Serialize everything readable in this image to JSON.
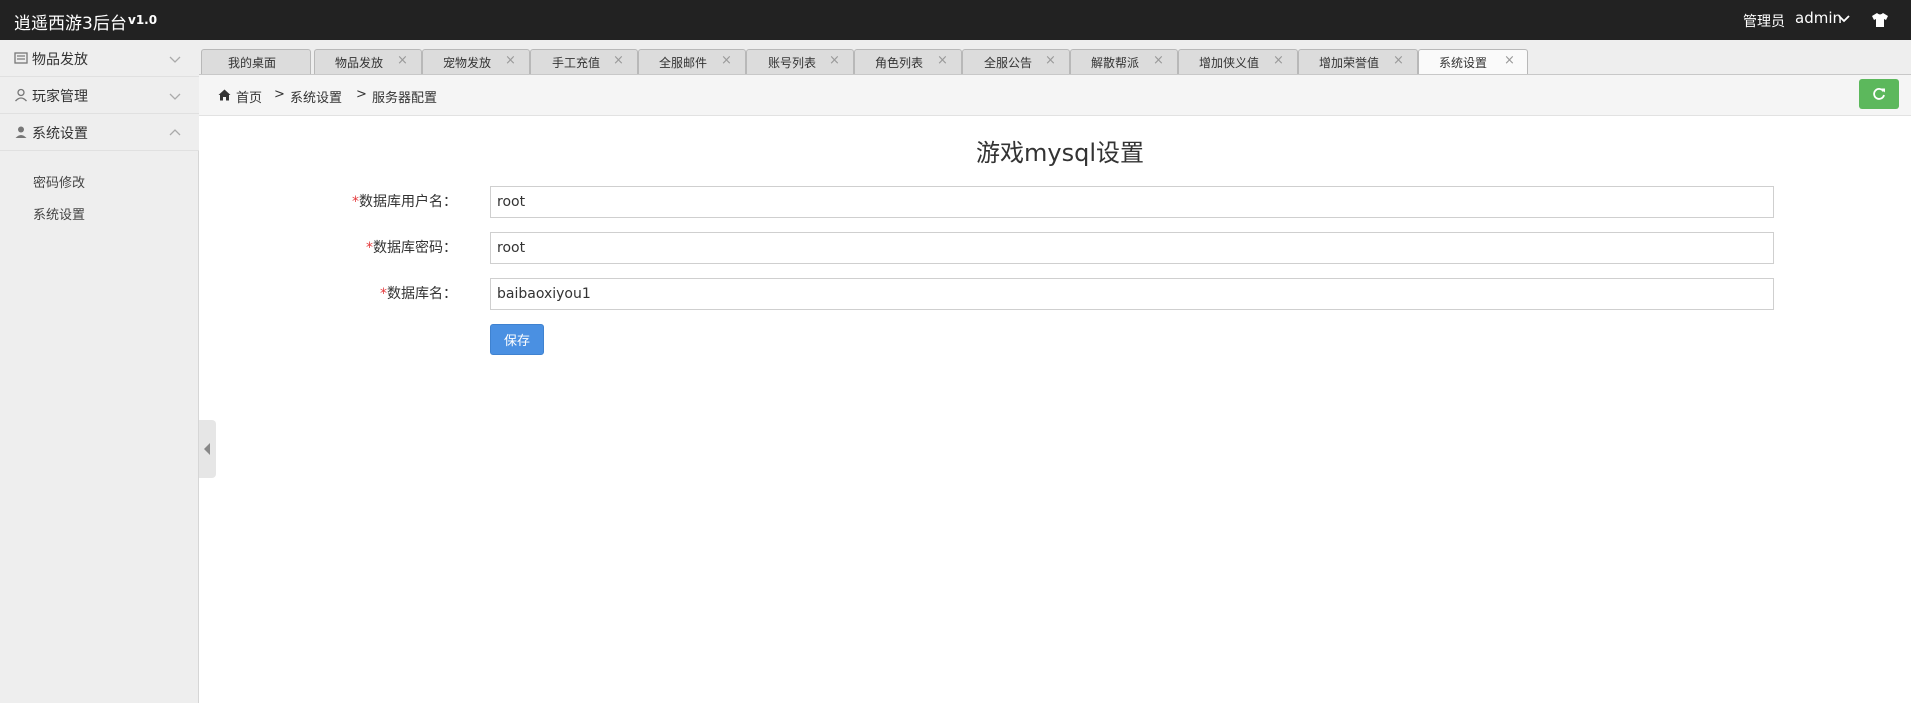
{
  "app": {
    "title": "逍遥西游3后台",
    "version": "v1.0"
  },
  "user": {
    "role": "管理员",
    "name": "admin",
    "icons": {
      "chevron": "chevron-down-icon",
      "theme": "shirt-icon"
    }
  },
  "sidebar": {
    "items": [
      {
        "label": "物品发放",
        "icon": "list-icon",
        "expanded": false
      },
      {
        "label": "玩家管理",
        "icon": "user-outline-icon",
        "expanded": false
      },
      {
        "label": "系统设置",
        "icon": "user-icon",
        "expanded": true
      }
    ],
    "subitems": [
      {
        "label": "密码修改"
      },
      {
        "label": "系统设置"
      }
    ]
  },
  "tabs": [
    {
      "label": "我的桌面",
      "closable": false
    },
    {
      "label": "物品发放",
      "closable": true
    },
    {
      "label": "宠物发放",
      "closable": true
    },
    {
      "label": "手工充值",
      "closable": true
    },
    {
      "label": "全服邮件",
      "closable": true
    },
    {
      "label": "账号列表",
      "closable": true
    },
    {
      "label": "角色列表",
      "closable": true
    },
    {
      "label": "全服公告",
      "closable": true
    },
    {
      "label": "解散帮派",
      "closable": true
    },
    {
      "label": "增加侠义值",
      "closable": true
    },
    {
      "label": "增加荣誉值",
      "closable": true
    },
    {
      "label": "系统设置",
      "closable": true,
      "active": true
    }
  ],
  "tab_close_glyph": "×",
  "breadcrumb": {
    "home": "首页",
    "sep": ">",
    "items": [
      "系统设置",
      "服务器配置"
    ]
  },
  "form": {
    "title": "游戏mysql设置",
    "required_mark": "*",
    "fields": [
      {
        "label": "数据库用户名：",
        "value": "root"
      },
      {
        "label": "数据库密码：",
        "value": "root"
      },
      {
        "label": "数据库名：",
        "value": "baibaoxiyou1"
      }
    ],
    "save_label": "保存"
  },
  "colors": {
    "topbar": "#222222",
    "refresh": "#5cb85c",
    "save": "#4a90e2",
    "required": "#e4393c"
  }
}
